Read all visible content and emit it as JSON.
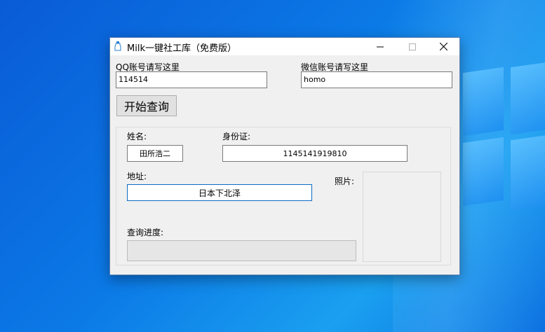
{
  "window": {
    "title": "Milk一键社工库（免费版）"
  },
  "form": {
    "qq_label": "QQ账号请写这里",
    "qq_value": "114514",
    "wechat_label": "微信账号请写这里",
    "wechat_value": "homo",
    "query_button": "开始查询"
  },
  "result": {
    "name_label": "姓名:",
    "name_value": "田所浩二",
    "id_label": "身份证:",
    "id_value": "1145141919810",
    "address_label": "地址:",
    "address_value": "日本下北泽",
    "photo_label": "照片:",
    "progress_label": "查询进度:",
    "progress_value": 0
  },
  "colors": {
    "progress_fill": "#06b025",
    "focus_border": "#0b6cc4"
  }
}
